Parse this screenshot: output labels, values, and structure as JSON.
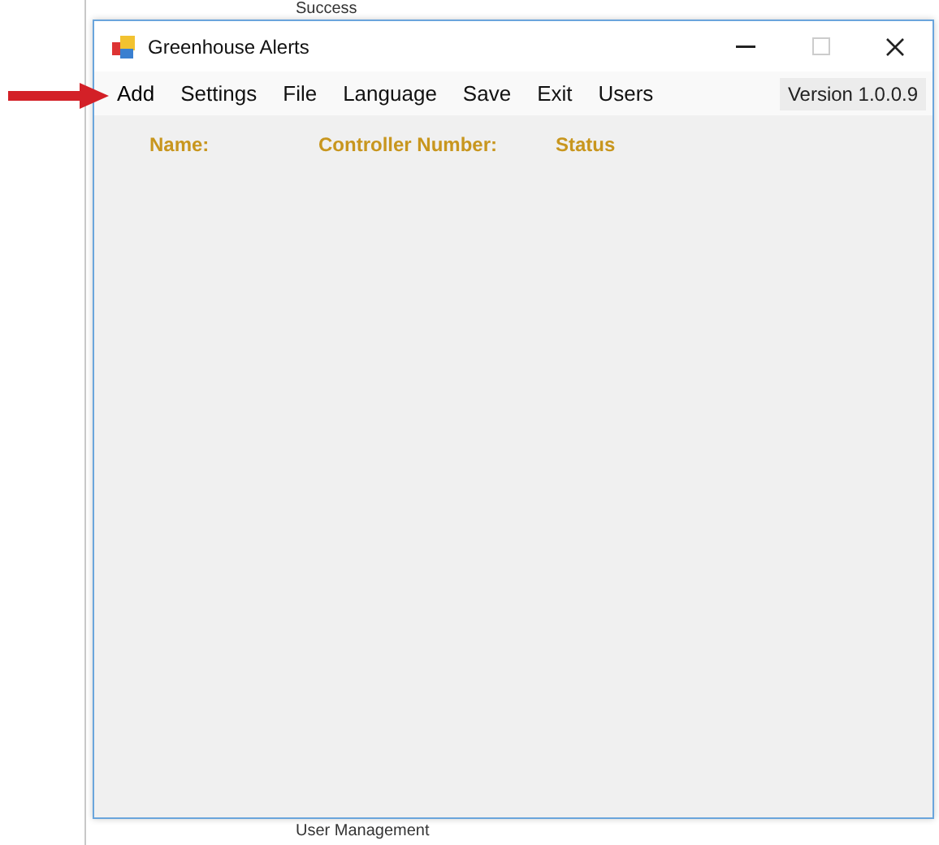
{
  "background_document": {
    "texts": [
      "Success",
      "User Management"
    ]
  },
  "window": {
    "title": "Greenhouse Alerts"
  },
  "menu": [
    {
      "label": "Add",
      "highlighted": true
    },
    {
      "label": "Settings",
      "highlighted": false
    },
    {
      "label": "File",
      "highlighted": false
    },
    {
      "label": "Language",
      "highlighted": false
    },
    {
      "label": "Save",
      "highlighted": false
    },
    {
      "label": "Exit",
      "highlighted": false
    },
    {
      "label": "Users",
      "highlighted": false
    }
  ],
  "version": "Version 1.0.0.9",
  "columns": [
    "Name:",
    "Controller Number:",
    "Status"
  ]
}
